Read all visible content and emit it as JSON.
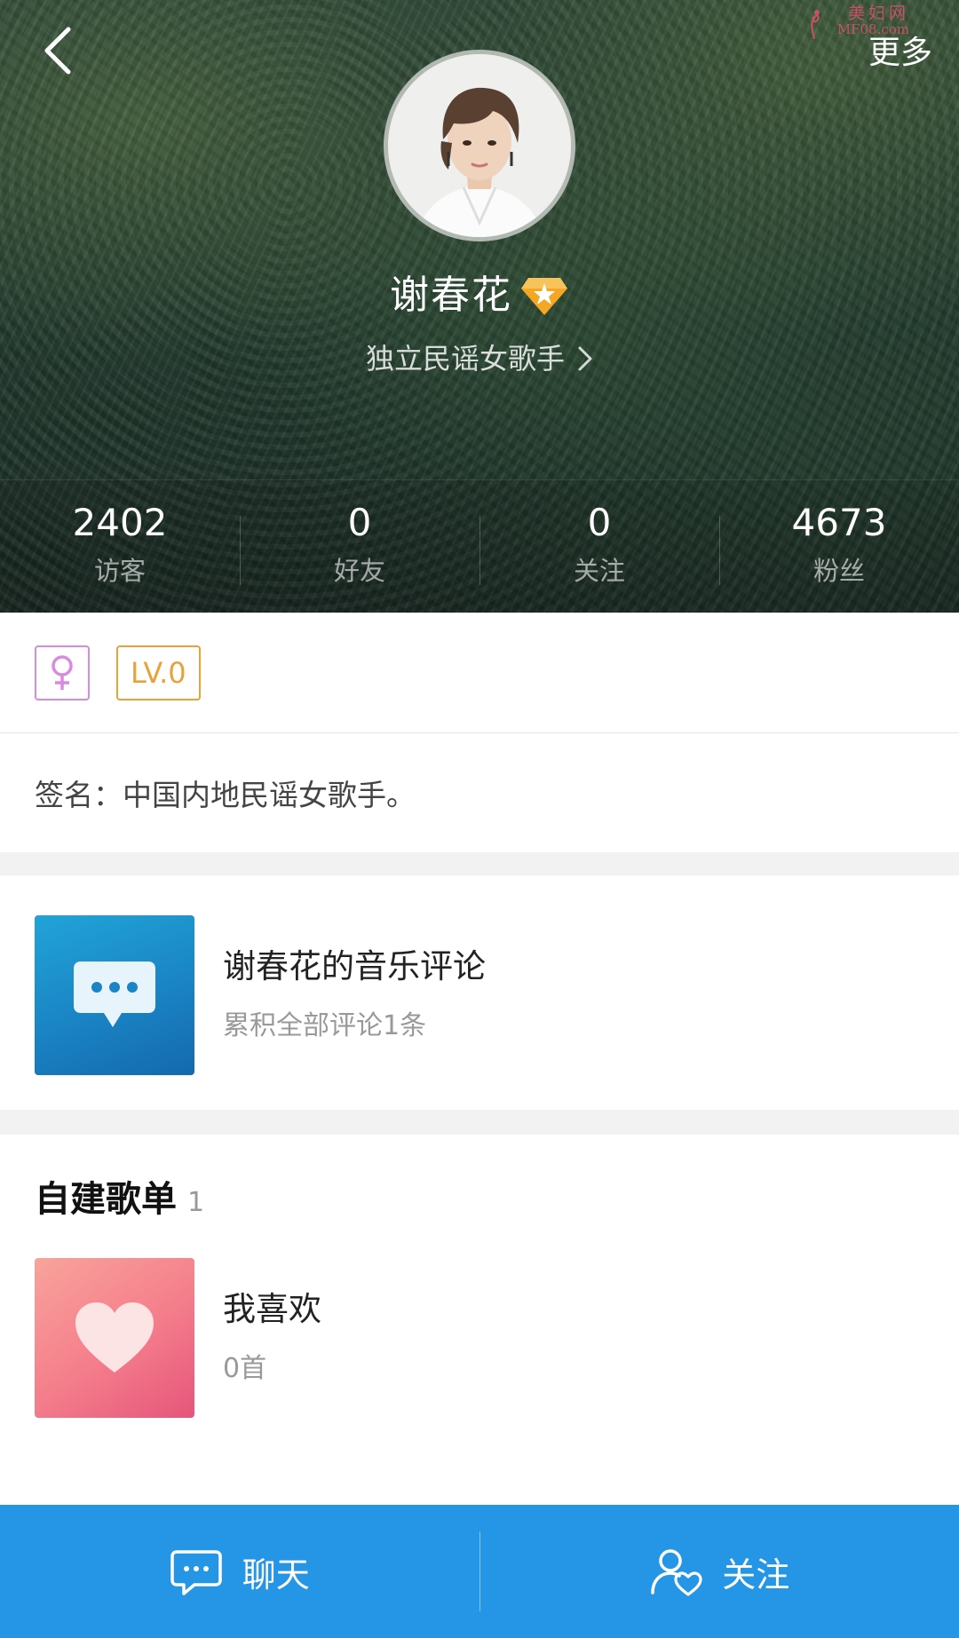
{
  "header": {
    "more_label": "更多",
    "watermark_top": "美妇网",
    "watermark_bottom": "MF08.com"
  },
  "profile": {
    "name": "谢春花",
    "title": "独立民谣女歌手",
    "stats": [
      {
        "value": "2402",
        "label": "访客"
      },
      {
        "value": "0",
        "label": "好友"
      },
      {
        "value": "0",
        "label": "关注"
      },
      {
        "value": "4673",
        "label": "粉丝"
      }
    ],
    "gender_icon": "female-icon",
    "level": "LV.0",
    "signature": "签名：中国内地民谣女歌手。"
  },
  "comment_card": {
    "title": "谢春花的音乐评论",
    "subtitle": "累积全部评论1条"
  },
  "playlists": {
    "section_title": "自建歌单",
    "count": "1",
    "items": [
      {
        "title": "我喜欢",
        "subtitle": "0首"
      }
    ]
  },
  "action_bar": {
    "chat_label": "聊天",
    "follow_label": "关注"
  },
  "colors": {
    "accent": "#2596e6",
    "level": "#e8a23a",
    "gender": "#d98ae0"
  }
}
